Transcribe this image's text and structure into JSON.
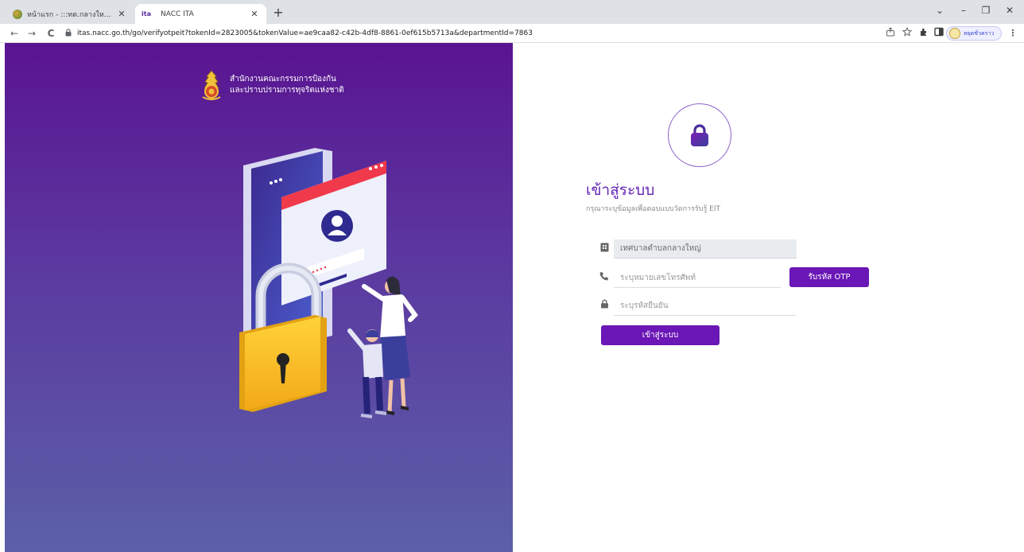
{
  "browser": {
    "tabs": [
      {
        "title": "หน้าแรก - :::ทต.กลางใหญ่ อ.บ้านผือ จ.:::",
        "active": false
      },
      {
        "title": "NACC ITA",
        "favicon_text": "ita",
        "active": true
      }
    ],
    "new_tab_label": "+",
    "close_glyph": "✕",
    "address": "itas.nacc.go.th/go/verifyotpeit?tokenId=2823005&tokenValue=ae9caa82-c42b-4df8-8861-0ef615b5713a&departmentId=7863",
    "profile_label": "หยุดชั่วคราว",
    "window_controls": {
      "dropdown": "⌄",
      "minimize": "–",
      "restore": "❐",
      "close": "✕"
    },
    "nav": {
      "back": "←",
      "forward": "→",
      "reload": "C"
    }
  },
  "organization": {
    "line1": "สำนักงานคณะกรรมการป้องกัน",
    "line2": "และปราบปรามการทุจริตแห่งชาติ"
  },
  "login": {
    "title": "เข้าสู่ระบบ",
    "subtitle": "กรุณาระบุข้อมูลเพื่อตอบแบบวัดการรับรู้ EIT",
    "organization_value": "เทศบาลตำบลกลางใหญ่",
    "phone_placeholder": "ระบุหมายเลขโทรศัพท์",
    "otp_button": "รับรหัส OTP",
    "code_placeholder": "ระบุรหัสยืนยัน",
    "submit_button": "เข้าสู่ระบบ"
  },
  "icons": {
    "lock": "lock-icon",
    "building": "building-icon",
    "phone": "phone-icon",
    "padlock_small": "small-lock-icon"
  },
  "colors": {
    "accent": "#6b16b6",
    "heading": "#6423b4",
    "panel_top": "#5a1491",
    "panel_bottom": "#5b60a8"
  }
}
